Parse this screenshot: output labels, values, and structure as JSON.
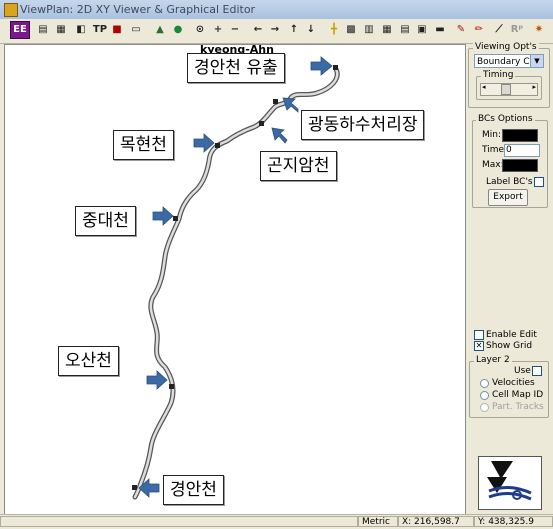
{
  "window": {
    "title": "ViewPlan: 2D XY Viewer & Graphical Editor"
  },
  "toolbar": {
    "buttons": [
      {
        "icon": "ee-icon",
        "label": "EE"
      },
      {
        "icon": "print-icon",
        "label": ""
      },
      {
        "icon": "page-icon",
        "label": ""
      },
      {
        "icon": "tool-2d-icon",
        "label": ""
      },
      {
        "icon": "tp-icon",
        "label": "TP"
      },
      {
        "icon": "save-icon",
        "label": ""
      },
      {
        "icon": "document-icon",
        "label": ""
      },
      {
        "icon": "mesh-icon",
        "label": ""
      },
      {
        "icon": "globe-icon",
        "label": ""
      },
      {
        "icon": "target-icon",
        "label": ""
      },
      {
        "icon": "zoom-in-icon",
        "label": ""
      },
      {
        "icon": "zoom-out-icon",
        "label": ""
      },
      {
        "icon": "arrow-left-icon",
        "label": ""
      },
      {
        "icon": "arrow-right-icon",
        "label": ""
      },
      {
        "icon": "arrow-up-icon",
        "label": ""
      },
      {
        "icon": "arrow-down-icon",
        "label": ""
      },
      {
        "icon": "grid-cross-icon",
        "label": ""
      },
      {
        "icon": "hatch-icon",
        "label": ""
      },
      {
        "icon": "table-icon",
        "label": ""
      },
      {
        "icon": "grid-icon",
        "label": ""
      },
      {
        "icon": "list-icon",
        "label": ""
      },
      {
        "icon": "box-icon",
        "label": ""
      },
      {
        "icon": "truck-icon",
        "label": ""
      },
      {
        "icon": "pen-icon",
        "label": ""
      },
      {
        "icon": "pencil-icon",
        "label": ""
      },
      {
        "icon": "ruler-icon",
        "label": ""
      },
      {
        "icon": "rp-icon",
        "label": "Rᵖ"
      },
      {
        "icon": "settings-icon",
        "label": ""
      }
    ]
  },
  "map": {
    "author_label": "kyeong-Ahn",
    "callouts": {
      "outlet": "경안천 유출",
      "gwangdong": "광동하수처리장",
      "mokhyeon": "목현천",
      "gonjiam": "곤지암천",
      "jungdae": "중대천",
      "osan": "오산천",
      "gyeongan": "경안천"
    }
  },
  "panel": {
    "viewing_opts": {
      "title": "Viewing Opt's",
      "select_value": "Boundary C's",
      "timing_label": "Timing"
    },
    "bcs_options": {
      "title": "BCs Options",
      "min_label": "Min:",
      "time_label": "Time:",
      "time_value": "0",
      "max_label": "Max:",
      "label_bcs": "Label BC's",
      "export_label": "Export"
    },
    "enable_edit_label": "Enable Edit",
    "show_grid_label": "Show Grid",
    "layer2": {
      "title": "Layer 2",
      "use_label": "Use",
      "velocities": "Velocities",
      "cell_map_id": "Cell Map ID",
      "part_tracks": "Part. Tracks"
    }
  },
  "status": {
    "units": "Metric",
    "x_readout": "X: 216,598.7",
    "y_readout": "Y: 438,325.9"
  }
}
